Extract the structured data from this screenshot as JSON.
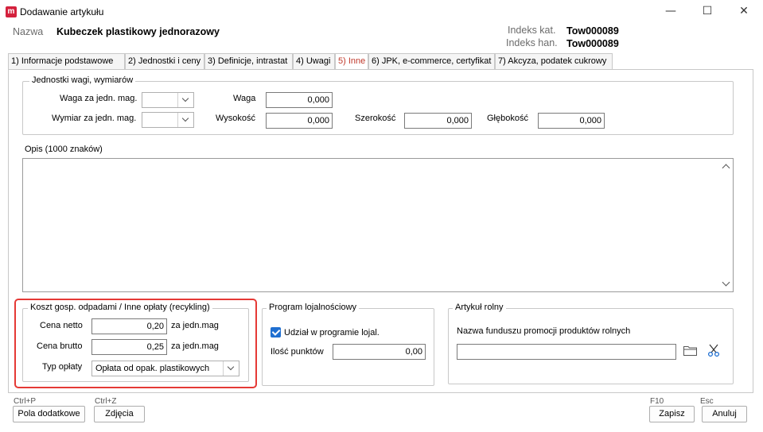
{
  "window": {
    "title": "Dodawanie artykułu",
    "icon_letter": "m",
    "brand_color": "#d4213d",
    "minimize_glyph": "—",
    "maximize_glyph": "☐",
    "close_glyph": "✕"
  },
  "header": {
    "name_label": "Nazwa",
    "name_value": "Kubeczek plastikowy jednorazowy",
    "indeks_kat_label": "Indeks kat.",
    "indeks_kat_value": "Tow000089",
    "indeks_han_label": "Indeks han.",
    "indeks_han_value": "Tow000089"
  },
  "tabs": [
    {
      "label": "1) Informacje podstawowe",
      "active": false
    },
    {
      "label": "2) Jednostki i ceny",
      "active": false
    },
    {
      "label": "3) Definicje, intrastat",
      "active": false
    },
    {
      "label": "4) Uwagi",
      "active": false
    },
    {
      "label": "5) Inne",
      "active": true
    },
    {
      "label": "6) JPK, e-commerce, certyfikat",
      "active": false
    },
    {
      "label": "7) Akcyza, podatek cukrowy",
      "active": false
    }
  ],
  "weights": {
    "title": "Jednostki wagi, wymiarów",
    "waga_jedn_label": "Waga za jedn. mag.",
    "waga_jedn_value": "",
    "wymiar_jedn_label": "Wymiar za jedn. mag.",
    "wymiar_jedn_value": "",
    "waga_label": "Waga",
    "waga_value": "0,000",
    "wysokosc_label": "Wysokość",
    "wysokosc_value": "0,000",
    "szerokosc_label": "Szerokość",
    "szerokosc_value": "0,000",
    "glebokosc_label": "Głębokość",
    "glebokosc_value": "0,000"
  },
  "opis": {
    "label": "Opis (1000 znaków)",
    "value": ""
  },
  "recycling": {
    "title": "Koszt gosp. odpadami / Inne opłaty (recykling)",
    "cena_netto_label": "Cena netto",
    "cena_netto_value": "0,20",
    "cena_brutto_label": "Cena brutto",
    "cena_brutto_value": "0,25",
    "unit_suffix": "za jedn.mag",
    "typ_label": "Typ opłaty",
    "typ_value": "Opłata od opak. plastikowych",
    "highlight_color": "#e53935"
  },
  "loyalty": {
    "title": "Program lojalnościowy",
    "udzial_label": "Udział w programie lojal.",
    "udzial_checked": true,
    "ilosc_label": "Ilość punktów",
    "ilosc_value": "0,00"
  },
  "rolny": {
    "title": "Artykuł rolny",
    "fundusz_label": "Nazwa funduszu promocji produktów rolnych",
    "fundusz_value": ""
  },
  "footer": {
    "pola_shortcut": "Ctrl+P",
    "pola_label": "Pola dodatkowe",
    "zdjecia_shortcut": "Ctrl+Z",
    "zdjecia_label": "Zdjęcia",
    "zapisz_shortcut": "F10",
    "zapisz_label": "Zapisz",
    "anuluj_shortcut": "Esc",
    "anuluj_label": "Anuluj"
  }
}
